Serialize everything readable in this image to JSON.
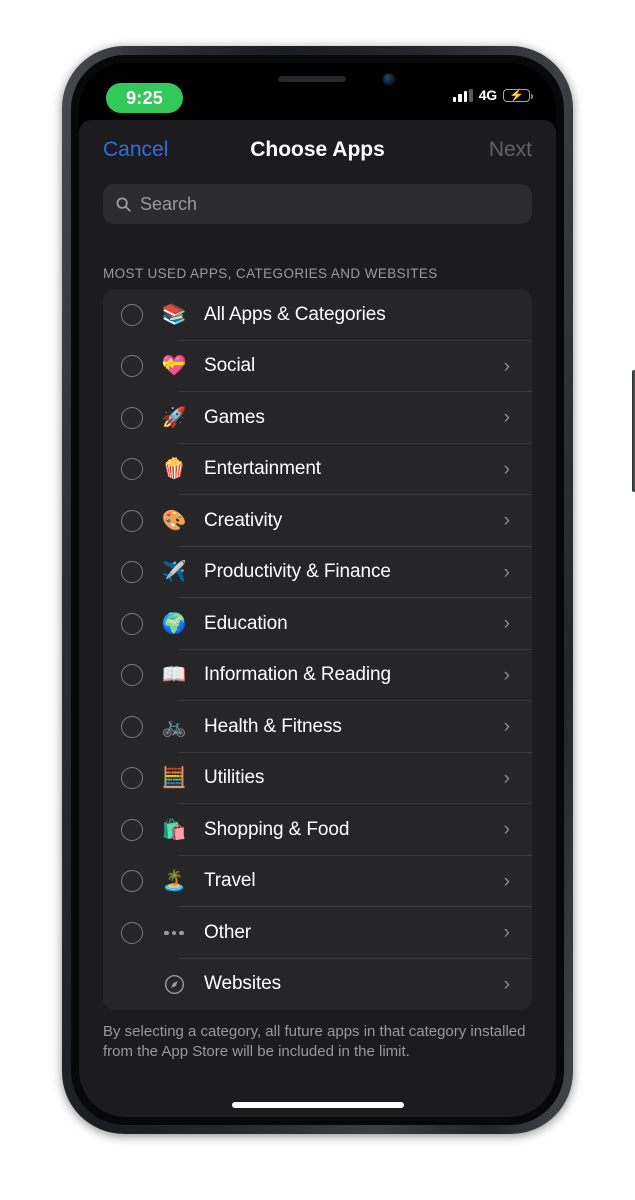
{
  "status_bar": {
    "time": "9:25",
    "network_type": "4G",
    "signal_icon": "cellular-signal-icon",
    "battery_icon": "battery-charging-icon",
    "battery_bolt": "⚡"
  },
  "nav": {
    "cancel_label": "Cancel",
    "title": "Choose Apps",
    "next_label": "Next"
  },
  "search": {
    "placeholder": "Search",
    "value": "",
    "icon": "search-icon"
  },
  "section": {
    "header": "MOST USED APPS, CATEGORIES AND WEBSITES"
  },
  "list": {
    "rows": [
      {
        "label": "All Apps & Categories",
        "icon": "📚",
        "icon_name": "stack-layers-icon",
        "radio": true,
        "chevron": false
      },
      {
        "label": "Social",
        "icon": "💝",
        "icon_name": "social-chat-heart-icon",
        "radio": true,
        "chevron": true
      },
      {
        "label": "Games",
        "icon": "🚀",
        "icon_name": "rocket-icon",
        "radio": true,
        "chevron": true
      },
      {
        "label": "Entertainment",
        "icon": "🍿",
        "icon_name": "popcorn-icon",
        "radio": true,
        "chevron": true
      },
      {
        "label": "Creativity",
        "icon": "🎨",
        "icon_name": "palette-icon",
        "radio": true,
        "chevron": true
      },
      {
        "label": "Productivity & Finance",
        "icon": "✈️",
        "icon_name": "paper-plane-icon",
        "radio": true,
        "chevron": true
      },
      {
        "label": "Education",
        "icon": "🌍",
        "icon_name": "globe-icon",
        "radio": true,
        "chevron": true
      },
      {
        "label": "Information & Reading",
        "icon": "📖",
        "icon_name": "open-book-icon",
        "radio": true,
        "chevron": true
      },
      {
        "label": "Health & Fitness",
        "icon": "🚲",
        "icon_name": "bicycle-icon",
        "radio": true,
        "chevron": true
      },
      {
        "label": "Utilities",
        "icon": "🧮",
        "icon_name": "calculator-icon",
        "radio": true,
        "chevron": true
      },
      {
        "label": "Shopping & Food",
        "icon": "🛍️",
        "icon_name": "shopping-bag-icon",
        "radio": true,
        "chevron": true
      },
      {
        "label": "Travel",
        "icon": "🏝️",
        "icon_name": "palm-island-icon",
        "radio": true,
        "chevron": true
      },
      {
        "label": "Other",
        "icon": "dots",
        "icon_name": "ellipsis-icon",
        "radio": true,
        "chevron": true
      },
      {
        "label": "Websites",
        "icon": "compass",
        "icon_name": "safari-compass-icon",
        "radio": false,
        "chevron": true
      }
    ],
    "chevron_glyph": "›"
  },
  "footer": {
    "note": "By selecting a category, all future apps in that category installed from the App Store will be included in the limit."
  },
  "colors": {
    "accent_blue": "#2f6ee0",
    "clock_green": "#34c759",
    "battery_yellow": "#ffd60a",
    "card_bg": "#262628",
    "sheet_bg": "#1c1c1e"
  }
}
